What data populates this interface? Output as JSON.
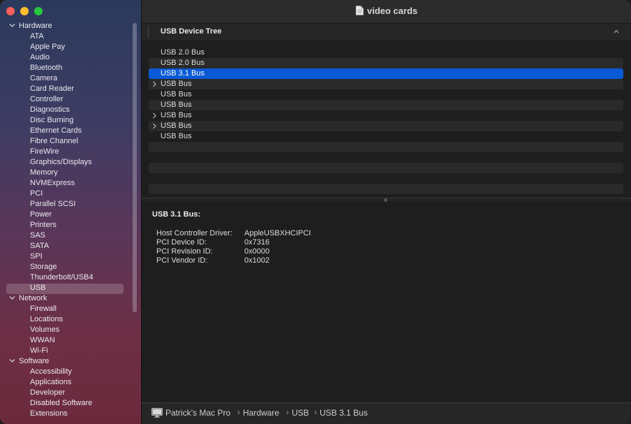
{
  "window": {
    "title": "video cards"
  },
  "sidebar": {
    "categories": [
      {
        "label": "Hardware",
        "expanded": true,
        "items": [
          "ATA",
          "Apple Pay",
          "Audio",
          "Bluetooth",
          "Camera",
          "Card Reader",
          "Controller",
          "Diagnostics",
          "Disc Burning",
          "Ethernet Cards",
          "Fibre Channel",
          "FireWire",
          "Graphics/Displays",
          "Memory",
          "NVMExpress",
          "PCI",
          "Parallel SCSI",
          "Power",
          "Printers",
          "SAS",
          "SATA",
          "SPI",
          "Storage",
          "Thunderbolt/USB4",
          "USB"
        ]
      },
      {
        "label": "Network",
        "expanded": true,
        "items": [
          "Firewall",
          "Locations",
          "Volumes",
          "WWAN",
          "Wi-Fi"
        ]
      },
      {
        "label": "Software",
        "expanded": true,
        "items": [
          "Accessibility",
          "Applications",
          "Developer",
          "Disabled Software",
          "Extensions"
        ]
      }
    ],
    "selected": "USB"
  },
  "tree": {
    "header": "USB Device Tree",
    "rows": [
      {
        "label": "USB 2.0 Bus",
        "expandable": false
      },
      {
        "label": "USB 2.0 Bus",
        "expandable": false
      },
      {
        "label": "USB 3.1 Bus",
        "expandable": false,
        "selected": true
      },
      {
        "label": "USB Bus",
        "expandable": true
      },
      {
        "label": "USB Bus",
        "expandable": false
      },
      {
        "label": "USB Bus",
        "expandable": false
      },
      {
        "label": "USB Bus",
        "expandable": true
      },
      {
        "label": "USB Bus",
        "expandable": true
      },
      {
        "label": "USB Bus",
        "expandable": false
      }
    ]
  },
  "detail": {
    "title": "USB 3.1 Bus:",
    "fields": [
      {
        "label": "Host Controller Driver:",
        "value": "AppleUSBXHCIPCI"
      },
      {
        "label": "PCI Device ID:",
        "value": "0x7316"
      },
      {
        "label": "PCI Revision ID:",
        "value": "0x0000"
      },
      {
        "label": "PCI Vendor ID:",
        "value": "0x1002"
      }
    ]
  },
  "pathbar": {
    "separator": "›",
    "crumbs": [
      "Patrick’s Mac Pro",
      "Hardware",
      "USB",
      "USB 3.1 Bus"
    ]
  },
  "colors": {
    "selection": "#0a5ad6",
    "close": "#fe5f57",
    "minimize": "#febc2e",
    "maximize": "#28c840"
  }
}
